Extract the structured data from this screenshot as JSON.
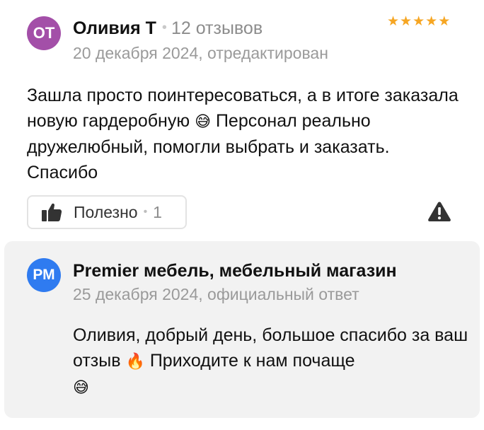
{
  "review": {
    "avatar_initials": "ОТ",
    "author_name": "Оливия Т",
    "reviews_count": "12 отзывов",
    "date": "20 декабря 2024, отредактирован",
    "rating": 5,
    "text_before_emoji": "Зашла просто поинтересоваться, а в итоге заказала новую гардеробную ",
    "text_emoji": "😅",
    "text_after_emoji": " Персонал реально дружелюбный, помогли выбрать и заказать. Спасибо",
    "helpful_label": "Полезно",
    "helpful_count": "1",
    "colors": {
      "avatar": "#a34fa8",
      "star": "#f6a623"
    }
  },
  "reply": {
    "avatar_initials": "РМ",
    "business_name": "Premier мебель, мебельный магазин",
    "date": "25 декабря 2024, официальный ответ",
    "text_part1": "Оливия, добрый день, большое спасибо за ваш отзыв ",
    "emoji1": "🔥",
    "text_part2": " Приходите к нам почаще ",
    "emoji2": "😅",
    "colors": {
      "avatar": "#2f7bf0",
      "background": "#f2f2f2"
    }
  }
}
